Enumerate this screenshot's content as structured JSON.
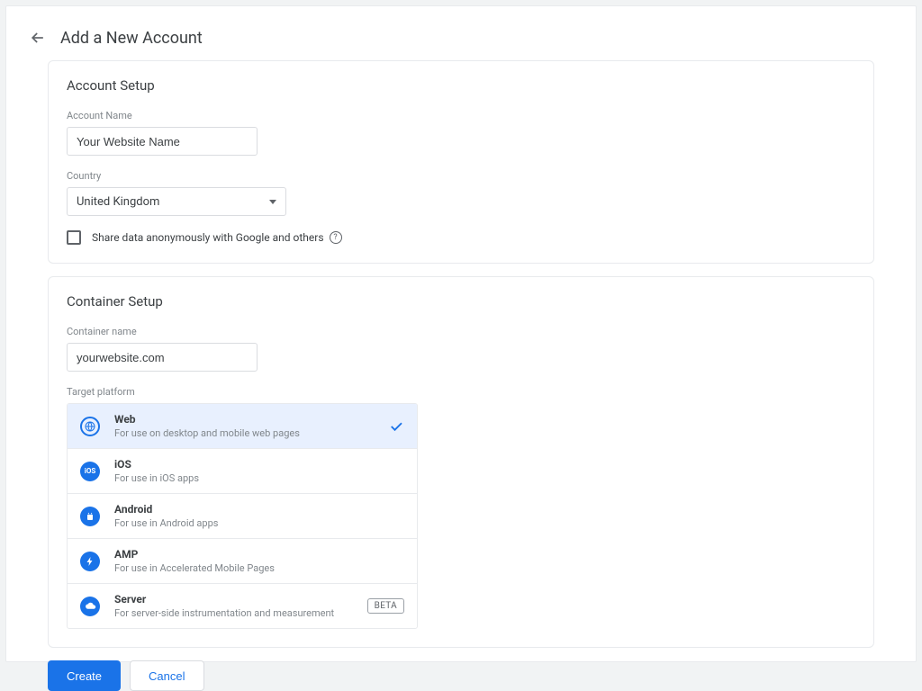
{
  "header": {
    "title": "Add a New Account"
  },
  "account": {
    "section_title": "Account Setup",
    "name_label": "Account Name",
    "name_value": "Your Website Name",
    "country_label": "Country",
    "country_value": "United Kingdom",
    "share_label": "Share data anonymously with Google and others"
  },
  "container": {
    "section_title": "Container Setup",
    "name_label": "Container name",
    "name_value": "yourwebsite.com",
    "platform_label": "Target platform",
    "platforms": [
      {
        "title": "Web",
        "desc": "For use on desktop and mobile web pages",
        "selected": true,
        "icon": "globe"
      },
      {
        "title": "iOS",
        "desc": "For use in iOS apps",
        "icon": "ios"
      },
      {
        "title": "Android",
        "desc": "For use in Android apps",
        "icon": "android"
      },
      {
        "title": "AMP",
        "desc": "For use in Accelerated Mobile Pages",
        "icon": "amp"
      },
      {
        "title": "Server",
        "desc": "For server-side instrumentation and measurement",
        "icon": "cloud",
        "badge": "BETA"
      }
    ]
  },
  "actions": {
    "create": "Create",
    "cancel": "Cancel"
  }
}
